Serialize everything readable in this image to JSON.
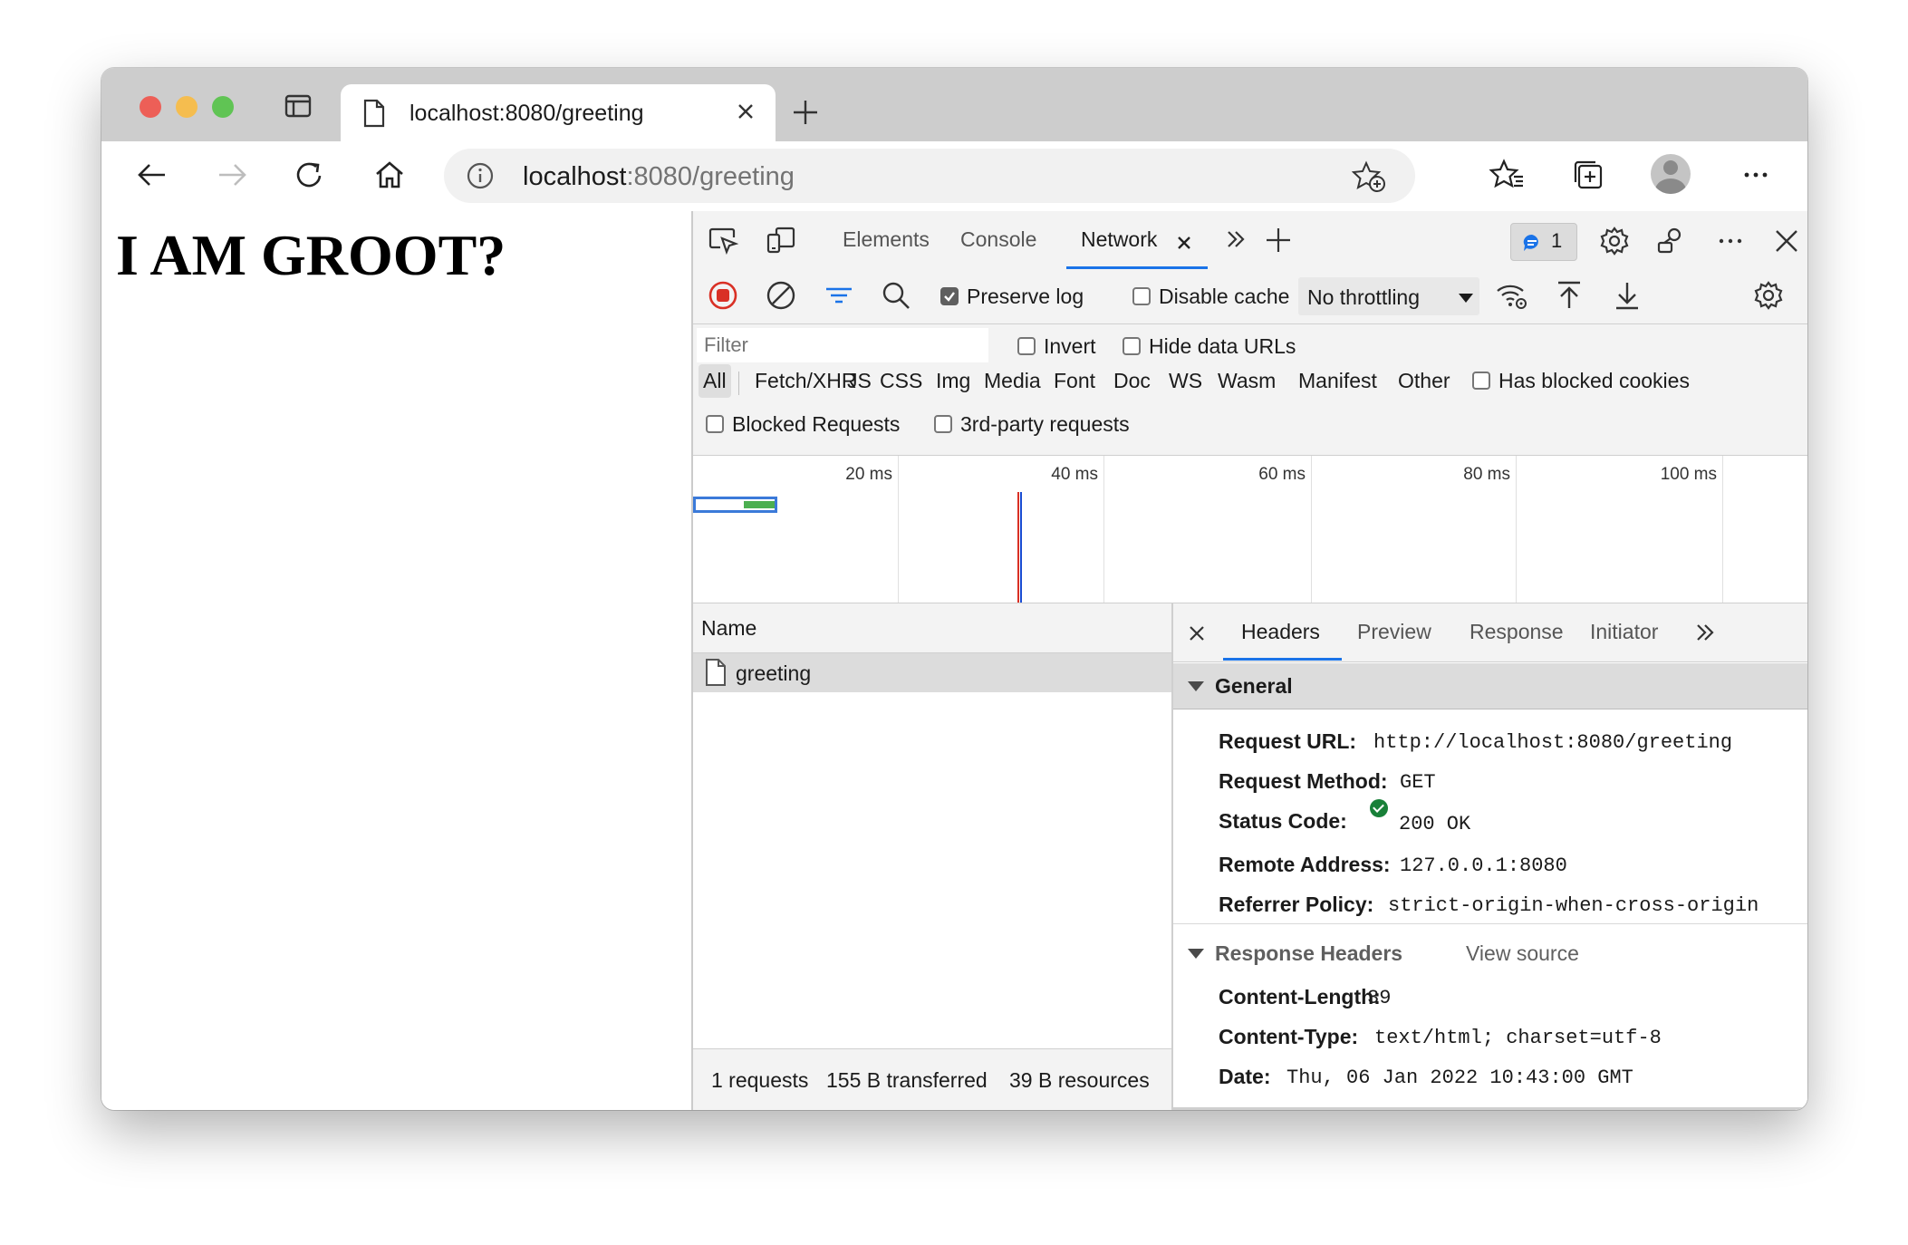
{
  "browser": {
    "tab_title": "localhost:8080/greeting",
    "address_host": "localhost",
    "address_rest": ":8080/greeting"
  },
  "page": {
    "heading": "I AM GROOT?"
  },
  "devtools": {
    "tabs": [
      "Elements",
      "Console",
      "Network"
    ],
    "issues_count": "1",
    "toolbar": {
      "preserve_log": "Preserve log",
      "preserve_log_checked": true,
      "disable_cache": "Disable cache",
      "disable_cache_checked": false,
      "throttling": "No throttling"
    },
    "filter": {
      "placeholder": "Filter",
      "invert": "Invert",
      "hide_data_urls": "Hide data URLs",
      "types": [
        "All",
        "Fetch/XHR",
        "JS",
        "CSS",
        "Img",
        "Media",
        "Font",
        "Doc",
        "WS",
        "Wasm",
        "Manifest",
        "Other"
      ],
      "active_type": "All",
      "has_blocked_cookies": "Has blocked cookies",
      "blocked_requests": "Blocked Requests",
      "third_party": "3rd-party requests"
    },
    "overview": {
      "ticks": [
        "20 ms",
        "40 ms",
        "60 ms",
        "80 ms",
        "100 ms"
      ]
    },
    "request_list": {
      "column_name": "Name",
      "rows": [
        {
          "name": "greeting"
        }
      ],
      "summary": {
        "requests": "1 requests",
        "transferred": "155 B transferred",
        "resources": "39 B resources"
      }
    },
    "details": {
      "tabs": [
        "Headers",
        "Preview",
        "Response",
        "Initiator"
      ],
      "active_tab": "Headers",
      "general_title": "General",
      "general": [
        {
          "key": "Request URL:",
          "value": "http://localhost:8080/greeting"
        },
        {
          "key": "Request Method:",
          "value": "GET"
        },
        {
          "key": "Status Code:",
          "value": "200 OK"
        },
        {
          "key": "Remote Address:",
          "value": "127.0.0.1:8080"
        },
        {
          "key": "Referrer Policy:",
          "value": "strict-origin-when-cross-origin"
        }
      ],
      "response_headers_title": "Response Headers",
      "view_source": "View source",
      "response_headers": [
        {
          "key": "Content-Length:",
          "value": "39"
        },
        {
          "key": "Content-Type:",
          "value": "text/html; charset=utf-8"
        },
        {
          "key": "Date:",
          "value": "Thu, 06 Jan 2022 10:43:00 GMT"
        }
      ]
    }
  },
  "colors": {
    "accent": "#1a73e8",
    "record_red": "#d93025",
    "status_ok": "#188038"
  }
}
